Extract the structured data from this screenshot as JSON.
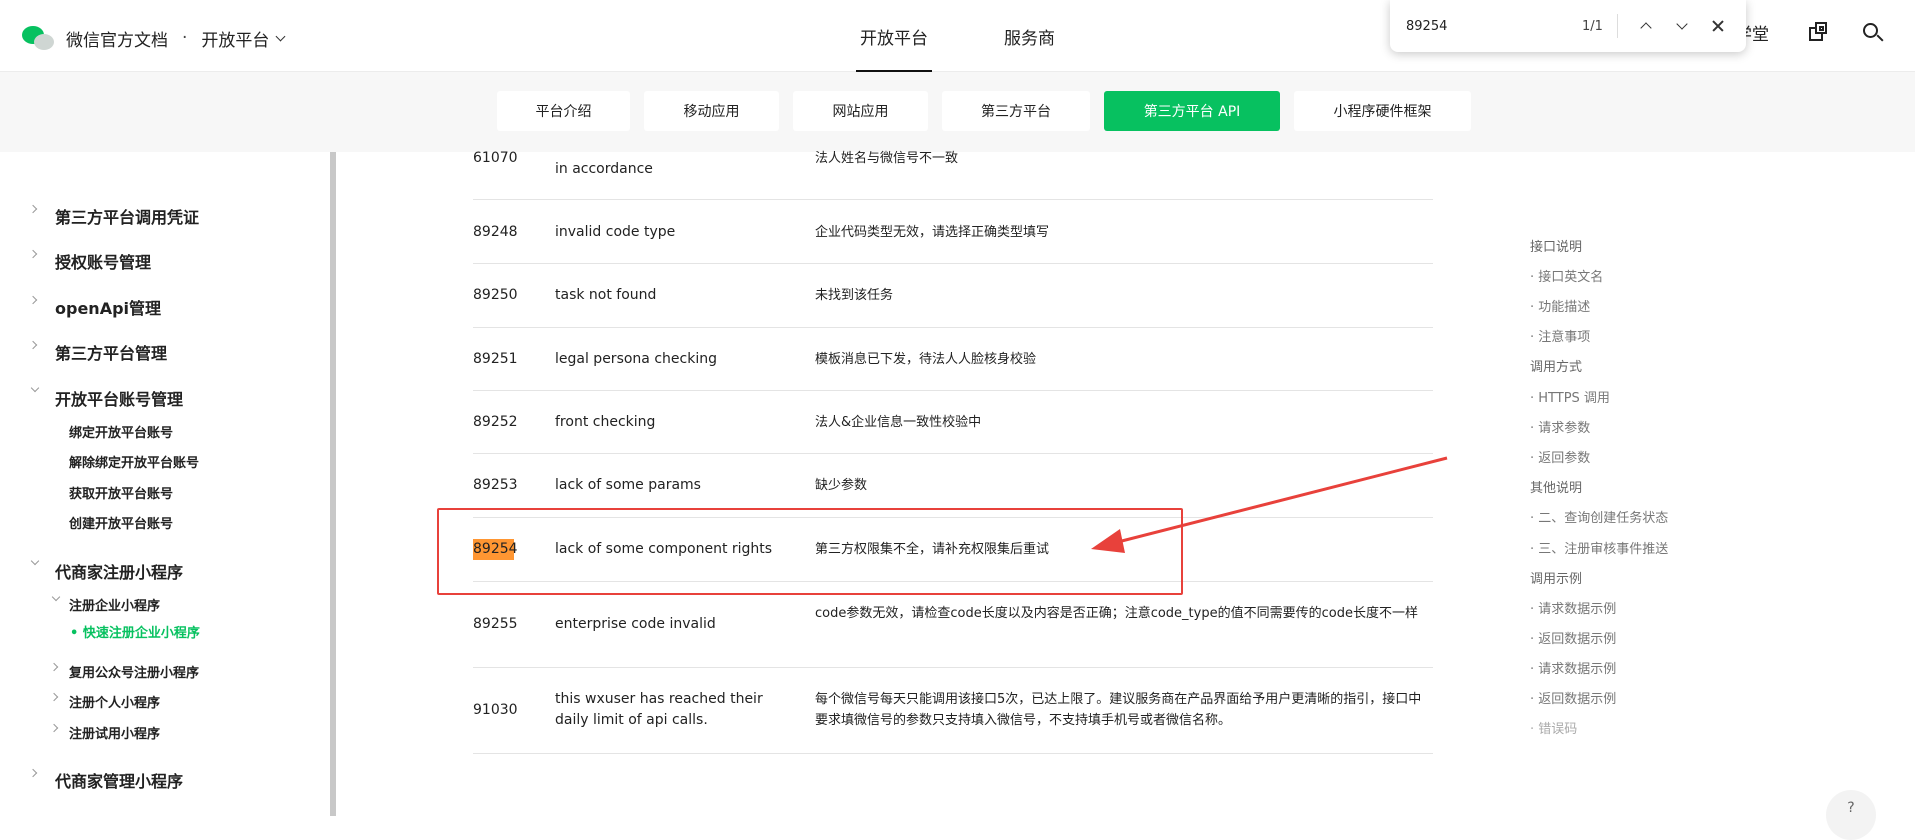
{
  "header": {
    "brand_title": "微信官方文档",
    "brand_dot": "·",
    "platform_select": "开放平台",
    "nav": [
      "开放平台",
      "服务商"
    ],
    "cut_text": "学堂"
  },
  "find_bar": {
    "query": "89254",
    "count": "1/1"
  },
  "tabs": [
    "平台介绍",
    "移动应用",
    "网站应用",
    "第三方平台",
    "第三方平台 API",
    "小程序硬件框架"
  ],
  "active_tab": "第三方平台 API",
  "sidebar": {
    "items": [
      {
        "label": "第三方平台调用凭证"
      },
      {
        "label": "授权账号管理"
      },
      {
        "label": "openApi管理"
      },
      {
        "label": "第三方平台管理"
      },
      {
        "label": "开放平台账号管理"
      },
      {
        "label": "绑定开放平台账号"
      },
      {
        "label": "解除绑定开放平台账号"
      },
      {
        "label": "获取开放平台账号"
      },
      {
        "label": "创建开放平台账号"
      },
      {
        "label": "代商家注册小程序"
      },
      {
        "label": "注册企业小程序"
      },
      {
        "label": "• 快速注册企业小程序"
      },
      {
        "label": "复用公众号注册小程序"
      },
      {
        "label": "注册个人小程序"
      },
      {
        "label": "注册试用小程序"
      },
      {
        "label": "代商家管理小程序"
      }
    ]
  },
  "table": {
    "rows": [
      {
        "code": "61070",
        "en": "in accordance",
        "cn": "法人姓名与微信号不一致"
      },
      {
        "code": "89248",
        "en": "invalid code type",
        "cn": "企业代码类型无效，请选择正确类型填写"
      },
      {
        "code": "89250",
        "en": "task not found",
        "cn": "未找到该任务"
      },
      {
        "code": "89251",
        "en": "legal persona checking",
        "cn": "模板消息已下发，待法人人脸核身校验"
      },
      {
        "code": "89252",
        "en": "front checking",
        "cn": "法人&企业信息一致性校验中"
      },
      {
        "code": "89253",
        "en": "lack of some params",
        "cn": "缺少参数"
      },
      {
        "code": "89254",
        "en": "lack of some component rights",
        "cn": "第三方权限集不全，请补充权限集后重试"
      },
      {
        "code": "89255",
        "en": "enterprise code invalid",
        "cn": "code参数无效，请检查code长度以及内容是否正确；注意code_type的值不同需要传的code长度不一样"
      },
      {
        "code": "91030",
        "en": "this wxuser has reached their daily limit of api calls.",
        "cn": "每个微信号每天只能调用该接口5次，已达上限了。建议服务商在产品界面给予用户更清晰的指引，接口中要求填微信号的参数只支持填入微信号，不支持填手机号或者微信名称。"
      }
    ]
  },
  "toc": {
    "items": [
      {
        "label": "接口说明"
      },
      {
        "label": "· 接口英文名"
      },
      {
        "label": "· 功能描述"
      },
      {
        "label": "· 注意事项"
      },
      {
        "label": "调用方式"
      },
      {
        "label": "· HTTPS 调用"
      },
      {
        "label": "· 请求参数"
      },
      {
        "label": "· 返回参数"
      },
      {
        "label": "其他说明"
      },
      {
        "label": "· 二、查询创建任务状态"
      },
      {
        "label": "· 三、注册审核事件推送"
      },
      {
        "label": "调用示例"
      },
      {
        "label": "· 请求数据示例"
      },
      {
        "label": "· 返回数据示例"
      },
      {
        "label": "· 请求数据示例"
      },
      {
        "label": "· 返回数据示例"
      },
      {
        "label": "· 错误码"
      }
    ]
  },
  "help_label": "?",
  "colors": {
    "accent": "#07c160",
    "highlight": "#ff9632",
    "annotation": "#e8413b"
  }
}
